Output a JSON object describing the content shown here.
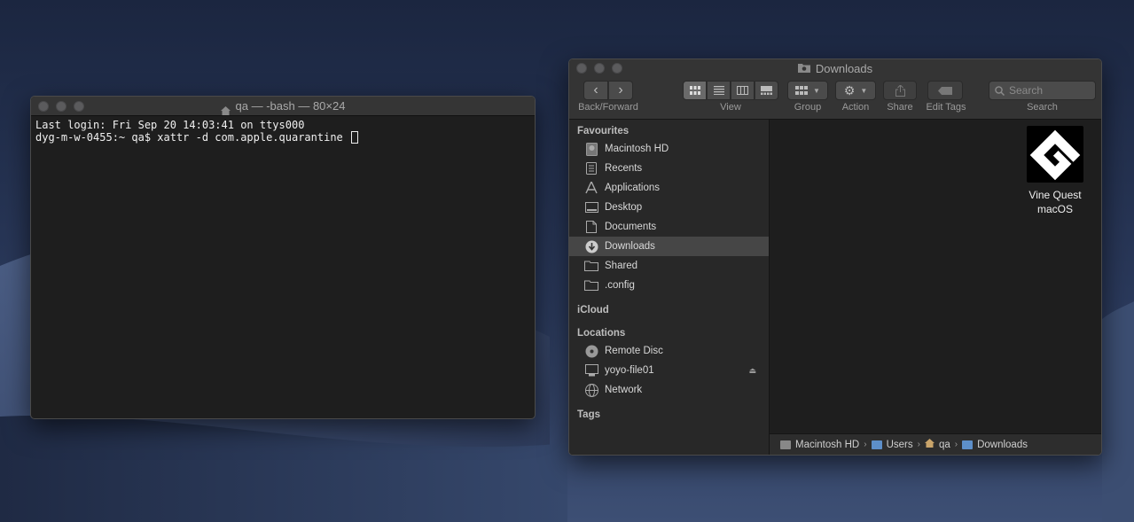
{
  "terminal": {
    "title": "qa — -bash — 80×24",
    "lines": [
      "Last login: Fri Sep 20 14:03:41 on ttys000",
      "dyg-m-w-0455:~ qa$ xattr -d com.apple.quarantine "
    ]
  },
  "finder": {
    "title": "Downloads",
    "toolbar": {
      "back_forward": "Back/Forward",
      "view": "View",
      "group": "Group",
      "action": "Action",
      "share": "Share",
      "edit_tags": "Edit Tags",
      "search_placeholder": "Search",
      "search_label": "Search"
    },
    "sidebar": {
      "favourites_heading": "Favourites",
      "favourites": [
        {
          "label": "Macintosh HD",
          "icon": "hard-drive-icon"
        },
        {
          "label": "Recents",
          "icon": "recents-icon"
        },
        {
          "label": "Applications",
          "icon": "applications-icon"
        },
        {
          "label": "Desktop",
          "icon": "desktop-icon"
        },
        {
          "label": "Documents",
          "icon": "documents-icon"
        },
        {
          "label": "Downloads",
          "icon": "downloads-icon"
        },
        {
          "label": "Shared",
          "icon": "folder-icon"
        },
        {
          "label": ".config",
          "icon": "folder-icon"
        }
      ],
      "icloud_heading": "iCloud",
      "locations_heading": "Locations",
      "locations": [
        {
          "label": "Remote Disc",
          "icon": "disc-icon"
        },
        {
          "label": "yoyo-file01",
          "icon": "server-icon"
        },
        {
          "label": "Network",
          "icon": "network-icon"
        }
      ],
      "tags_heading": "Tags"
    },
    "files": [
      {
        "name_line1": "Vine Quest",
        "name_line2": "macOS",
        "icon": "app-icon"
      }
    ],
    "path": [
      "Macintosh HD",
      "Users",
      "qa",
      "Downloads"
    ]
  }
}
